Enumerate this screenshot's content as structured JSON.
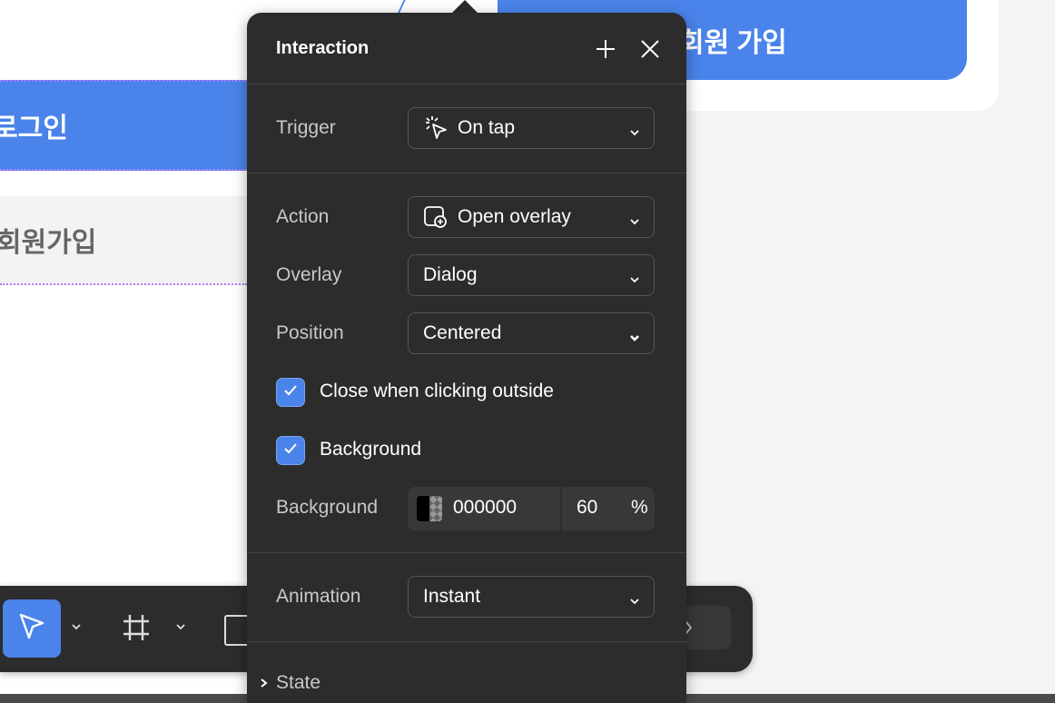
{
  "canvas": {
    "top_button_label": "회원 가입",
    "login_label": "로그인",
    "signup_label": "회원가입"
  },
  "panel": {
    "title": "Interaction",
    "trigger": {
      "label": "Trigger",
      "value": "On tap"
    },
    "action": {
      "label": "Action",
      "value": "Open overlay"
    },
    "overlay": {
      "label": "Overlay",
      "value": "Dialog"
    },
    "position": {
      "label": "Position",
      "value": "Centered"
    },
    "close_outside": {
      "label": "Close when clicking outside",
      "checked": true
    },
    "background_toggle": {
      "label": "Background",
      "checked": true
    },
    "background_color": {
      "label": "Background",
      "hex": "000000",
      "opacity": "60",
      "unit": "%"
    },
    "animation": {
      "label": "Animation",
      "value": "Instant"
    },
    "state": {
      "label": "State"
    }
  },
  "colors": {
    "accent": "#4a83ea",
    "panel_bg": "#2c2c2c"
  }
}
